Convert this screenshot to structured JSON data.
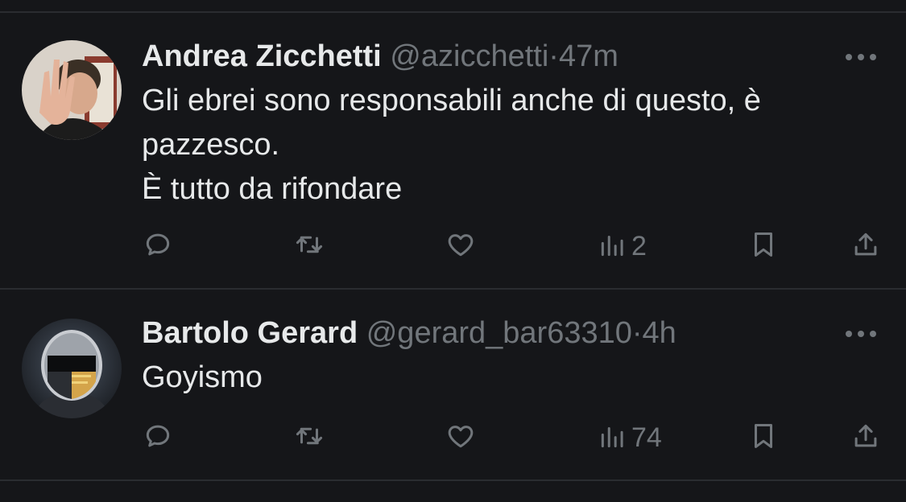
{
  "tweets": [
    {
      "display_name": "Andrea Zicchetti",
      "handle": "@azicchetti",
      "separator": "·",
      "time": "47m",
      "text": "Gli ebrei sono responsabili anche di questo, è\npazzesco.\nÈ tutto da rifondare",
      "views": "2",
      "avatar_icon": "user-avatar",
      "more_icon": "more-dots-icon"
    },
    {
      "display_name": "Bartolo Gerard",
      "handle": "@gerard_bar63310",
      "separator": "·",
      "time": "4h",
      "text": "Goyismo",
      "views": "74",
      "avatar_icon": "user-avatar",
      "more_icon": "more-dots-icon"
    }
  ],
  "icons": {
    "reply": "reply-icon",
    "retweet": "retweet-icon",
    "like": "heart-icon",
    "views": "views-chart-icon",
    "bookmark": "bookmark-icon",
    "share": "share-icon"
  },
  "colors": {
    "background": "#151619",
    "text_primary": "#e7e9ea",
    "text_secondary": "#71767b",
    "divider": "#2a2c30"
  }
}
